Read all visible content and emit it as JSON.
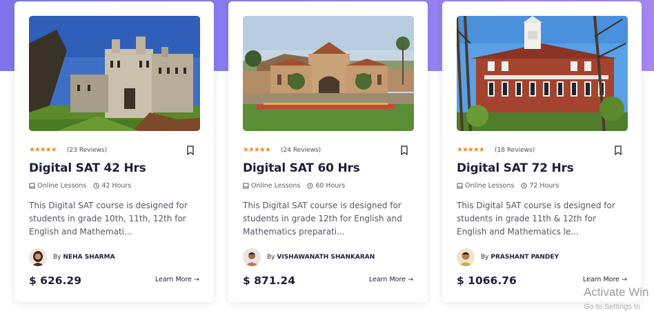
{
  "colors": {
    "band_start": "#7d74ec",
    "band_end": "#a886f0",
    "star": "#f08a2d",
    "title": "#1e1f3a"
  },
  "courses": [
    {
      "stars": "★★★★★",
      "rating": 5,
      "reviews": "(23 Reviews)",
      "title": "Digital SAT 42 Hrs",
      "mode": "Online Lessons",
      "hours": "42 Hours",
      "description": "This Digital SAT course is designed for students in grade 10th, 11th, 12th for English and Mathemati...",
      "by": "By",
      "author": "NEHA SHARMA",
      "price": "$ 626.29",
      "cta": "Learn More →",
      "image": "gothic-stone-university-building"
    },
    {
      "stars": "★★★★★",
      "rating": 5,
      "reviews": "(24 Reviews)",
      "title": "Digital SAT 60 Hrs",
      "mode": "Online Lessons",
      "hours": "60 Hours",
      "description": "This Digital SAT course is designed for students in grade 12th for English and Mathematics preparati...",
      "by": "By",
      "author": "VISHAWANATH SHANKARAN",
      "price": "$ 871.24",
      "cta": "Learn More →",
      "image": "stanford-main-quad-church"
    },
    {
      "stars": "★★★★★",
      "rating": 5,
      "reviews": "(18 Reviews)",
      "title": "Digital SAT 72 Hrs",
      "mode": "Online Lessons",
      "hours": "72 Hours",
      "description": "This Digital SAT course is designed for students in grade 11th & 12th for English and Mathematics le...",
      "by": "By",
      "author": "PRASHANT PANDEY",
      "price": "$ 1066.76",
      "cta": "Learn More →",
      "image": "red-brick-hall-with-cupola"
    }
  ],
  "watermark": {
    "line1": "Activate Win",
    "line2": "Go to Settings to"
  }
}
